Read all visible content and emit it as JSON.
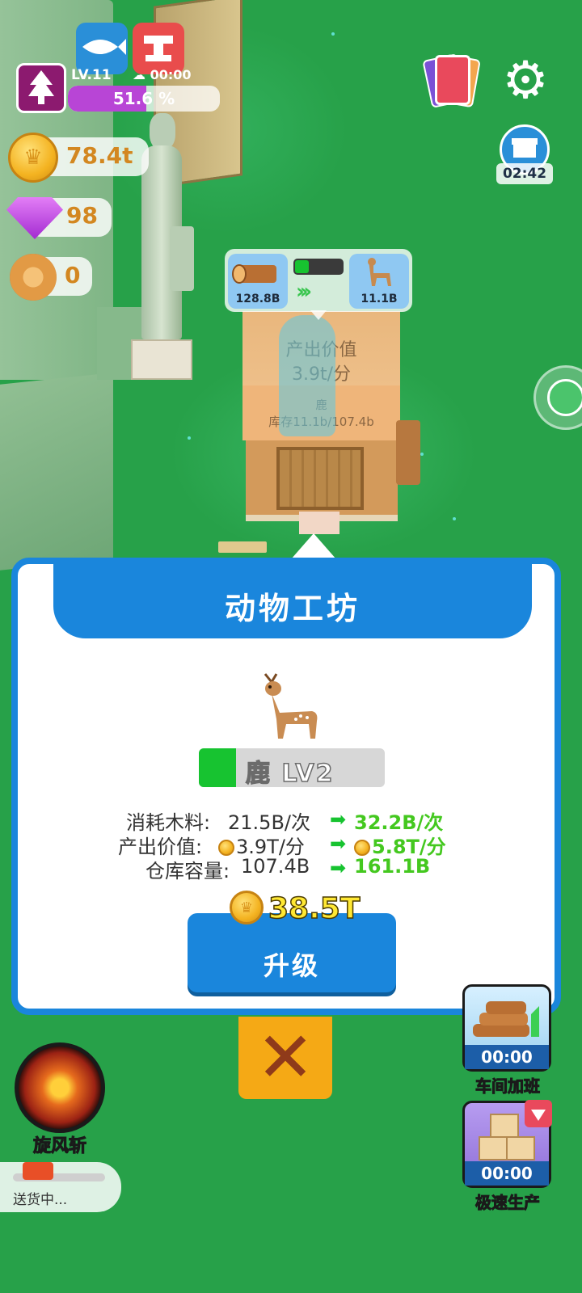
{
  "hud": {
    "level": "LV.11",
    "weather_timer": "00:00",
    "xp_percent_text": "51.6 %",
    "xp_percent": 51.6,
    "coins": "78.4t",
    "gems": "98",
    "wood": "0",
    "shop_timer": "02:42"
  },
  "production": {
    "input_amount": "128.8B",
    "output_amount": "11.1B",
    "progress": 0.3
  },
  "workshop_label": {
    "output_value_title": "产出价值",
    "output_value": "3.9t/分",
    "product_name": "鹿",
    "storage": "库存11.1b/107.4b"
  },
  "panel": {
    "title": "动物工坊",
    "product_level": "鹿 LV2",
    "level_progress": 0.2,
    "stats": [
      {
        "label": "消耗木料:",
        "old": "21.5B/次",
        "new": "32.2B/次",
        "coin": false
      },
      {
        "label": "产出价值:",
        "old": "3.9T/分",
        "new": "5.8T/分",
        "coin": true
      },
      {
        "label": "仓库容量:",
        "old": "107.4B",
        "new": "161.1B",
        "coin": false
      }
    ],
    "upgrade_cost": "38.5T",
    "upgrade_label": "升级"
  },
  "skills": {
    "whirlwind_label": "旋风斩",
    "delivery_text": "送货中..."
  },
  "boosts": [
    {
      "time": "00:00",
      "label": "车间加班"
    },
    {
      "time": "00:00",
      "label": "极速生产"
    }
  ],
  "colors": {
    "grass": "#27a149",
    "panel_blue": "#1a86dc",
    "upgrade_green": "#44c81f",
    "close_orange": "#f5a915"
  }
}
